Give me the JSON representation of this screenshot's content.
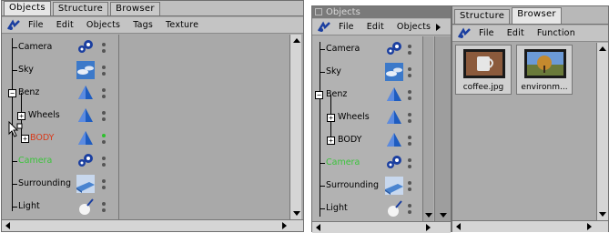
{
  "left": {
    "tabs": [
      "Objects",
      "Structure",
      "Browser"
    ],
    "menu": [
      "File",
      "Edit",
      "Objects",
      "Tags",
      "Texture"
    ],
    "items": [
      {
        "label": "Camera",
        "icon": "camera-icon",
        "color": "#000000"
      },
      {
        "label": "Sky",
        "icon": "sky-icon",
        "color": "#000000"
      },
      {
        "label": "Benz",
        "icon": "null-object-icon",
        "color": "#000000"
      },
      {
        "label": "Wheels",
        "icon": "null-object-icon",
        "color": "#000000"
      },
      {
        "label": "BODY",
        "icon": "null-object-icon",
        "color": "#d83a1a"
      },
      {
        "label": "Camera",
        "icon": "camera-icon",
        "color": "#3bc43b"
      },
      {
        "label": "Surrounding",
        "icon": "floor-icon",
        "color": "#000000"
      },
      {
        "label": "Light",
        "icon": "light-icon",
        "color": "#000000"
      }
    ]
  },
  "right": {
    "title": "Objects",
    "menu": [
      "File",
      "Edit",
      "Objects"
    ],
    "items": [
      "Camera",
      "Sky",
      "Benz",
      "Wheels",
      "BODY",
      "Camera",
      "Surrounding",
      "Light"
    ],
    "browser_tabs": [
      "Structure",
      "Browser"
    ],
    "browser_menu": [
      "File",
      "Edit",
      "Function"
    ],
    "files": [
      {
        "name": "coffee.jpg",
        "icon": "coffee-mug-image"
      },
      {
        "name": "environm...",
        "icon": "landscape-image"
      }
    ]
  }
}
